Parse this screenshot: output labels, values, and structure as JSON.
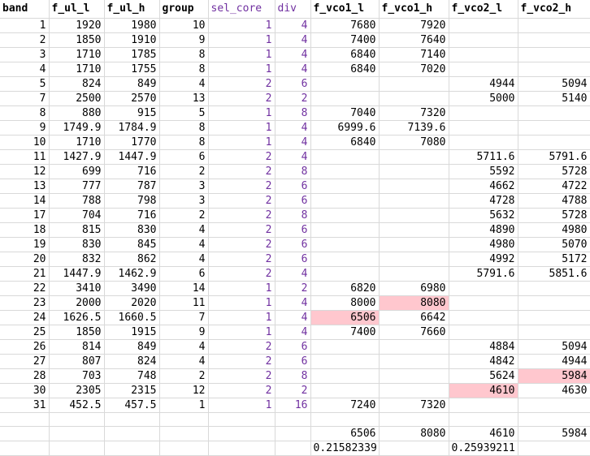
{
  "headers": [
    "band",
    "f_ul_l",
    "f_ul_h",
    "group",
    "sel_core",
    "div",
    "f_vco1_l",
    "f_vco1_h",
    "f_vco2_l",
    "f_vco2_h"
  ],
  "rows": [
    [
      "1",
      "1920",
      "1980",
      "10",
      "1",
      "4",
      "7680",
      "7920",
      "",
      ""
    ],
    [
      "2",
      "1850",
      "1910",
      "9",
      "1",
      "4",
      "7400",
      "7640",
      "",
      ""
    ],
    [
      "3",
      "1710",
      "1785",
      "8",
      "1",
      "4",
      "6840",
      "7140",
      "",
      ""
    ],
    [
      "4",
      "1710",
      "1755",
      "8",
      "1",
      "4",
      "6840",
      "7020",
      "",
      ""
    ],
    [
      "5",
      "824",
      "849",
      "4",
      "2",
      "6",
      "",
      "",
      "4944",
      "5094"
    ],
    [
      "7",
      "2500",
      "2570",
      "13",
      "2",
      "2",
      "",
      "",
      "5000",
      "5140"
    ],
    [
      "8",
      "880",
      "915",
      "5",
      "1",
      "8",
      "7040",
      "7320",
      "",
      ""
    ],
    [
      "9",
      "1749.9",
      "1784.9",
      "8",
      "1",
      "4",
      "6999.6",
      "7139.6",
      "",
      ""
    ],
    [
      "10",
      "1710",
      "1770",
      "8",
      "1",
      "4",
      "6840",
      "7080",
      "",
      ""
    ],
    [
      "11",
      "1427.9",
      "1447.9",
      "6",
      "2",
      "4",
      "",
      "",
      "5711.6",
      "5791.6"
    ],
    [
      "12",
      "699",
      "716",
      "2",
      "2",
      "8",
      "",
      "",
      "5592",
      "5728"
    ],
    [
      "13",
      "777",
      "787",
      "3",
      "2",
      "6",
      "",
      "",
      "4662",
      "4722"
    ],
    [
      "14",
      "788",
      "798",
      "3",
      "2",
      "6",
      "",
      "",
      "4728",
      "4788"
    ],
    [
      "17",
      "704",
      "716",
      "2",
      "2",
      "8",
      "",
      "",
      "5632",
      "5728"
    ],
    [
      "18",
      "815",
      "830",
      "4",
      "2",
      "6",
      "",
      "",
      "4890",
      "4980"
    ],
    [
      "19",
      "830",
      "845",
      "4",
      "2",
      "6",
      "",
      "",
      "4980",
      "5070"
    ],
    [
      "20",
      "832",
      "862",
      "4",
      "2",
      "6",
      "",
      "",
      "4992",
      "5172"
    ],
    [
      "21",
      "1447.9",
      "1462.9",
      "6",
      "2",
      "4",
      "",
      "",
      "5791.6",
      "5851.6"
    ],
    [
      "22",
      "3410",
      "3490",
      "14",
      "1",
      "2",
      "6820",
      "6980",
      "",
      ""
    ],
    [
      "23",
      "2000",
      "2020",
      "11",
      "1",
      "4",
      "8000",
      "8080",
      "",
      ""
    ],
    [
      "24",
      "1626.5",
      "1660.5",
      "7",
      "1",
      "4",
      "6506",
      "6642",
      "",
      ""
    ],
    [
      "25",
      "1850",
      "1915",
      "9",
      "1",
      "4",
      "7400",
      "7660",
      "",
      ""
    ],
    [
      "26",
      "814",
      "849",
      "4",
      "2",
      "6",
      "",
      "",
      "4884",
      "5094"
    ],
    [
      "27",
      "807",
      "824",
      "4",
      "2",
      "6",
      "",
      "",
      "4842",
      "4944"
    ],
    [
      "28",
      "703",
      "748",
      "2",
      "2",
      "8",
      "",
      "",
      "5624",
      "5984"
    ],
    [
      "30",
      "2305",
      "2315",
      "12",
      "2",
      "2",
      "",
      "",
      "4610",
      "4630"
    ],
    [
      "31",
      "452.5",
      "457.5",
      "1",
      "1",
      "16",
      "7240",
      "7320",
      "",
      ""
    ],
    [
      "",
      "",
      "",
      "",
      "",
      "",
      "",
      "",
      "",
      ""
    ],
    [
      "",
      "",
      "",
      "",
      "",
      "",
      "6506",
      "8080",
      "4610",
      "5984"
    ],
    [
      "",
      "",
      "",
      "",
      "",
      "",
      "0.21582339",
      "",
      "0.25939211",
      ""
    ]
  ],
  "highlights": [
    [
      19,
      7
    ],
    [
      20,
      6
    ],
    [
      24,
      9
    ],
    [
      25,
      8
    ]
  ],
  "left_aligned": [
    [
      29,
      6
    ],
    [
      29,
      8
    ]
  ],
  "colors": {
    "purple": "#7030a0",
    "highlight": "#ffc7ce",
    "grid": "#d9d9d9"
  }
}
